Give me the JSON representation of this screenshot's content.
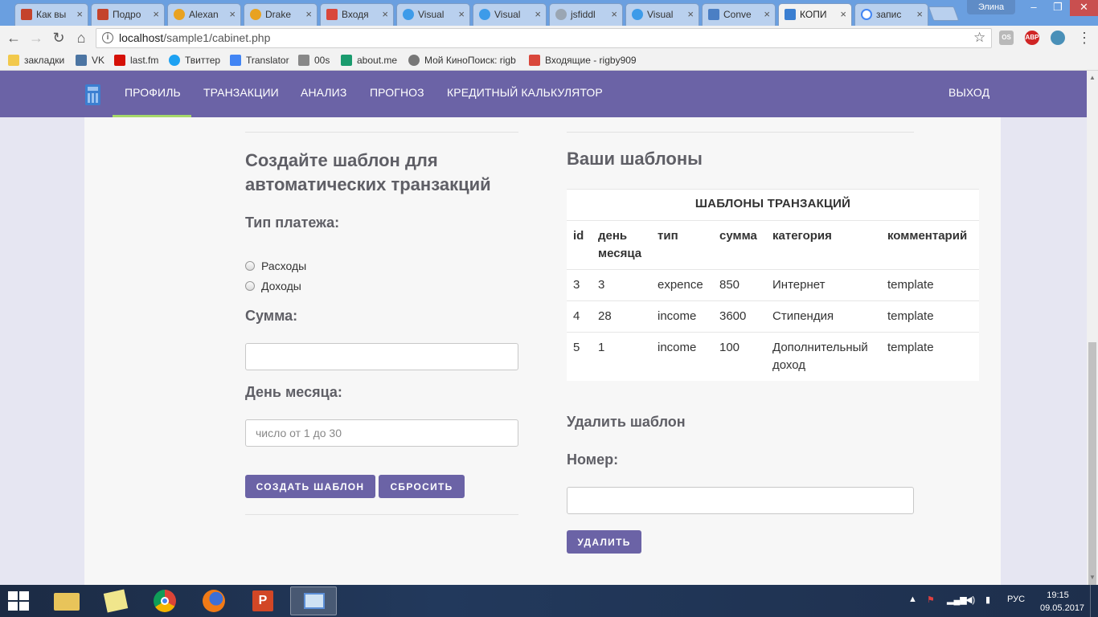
{
  "browser": {
    "tabs": [
      {
        "label": "Как вы",
        "favicon": "ru-site-icon"
      },
      {
        "label": "Подро",
        "favicon": "ru-site-icon"
      },
      {
        "label": "Alexan",
        "favicon": "music-icon"
      },
      {
        "label": "Drake",
        "favicon": "music-icon"
      },
      {
        "label": "Входя",
        "favicon": "gmail-icon"
      },
      {
        "label": "Visual",
        "favicon": "chrome-store-icon"
      },
      {
        "label": "Visual",
        "favicon": "chrome-store-icon"
      },
      {
        "label": "jsfiddl",
        "favicon": "jsfiddle-icon"
      },
      {
        "label": "Visual",
        "favicon": "chrome-store-icon"
      },
      {
        "label": "Conve",
        "favicon": "chat-icon"
      },
      {
        "label": "КОПИ",
        "favicon": "calculator-icon",
        "active": true
      },
      {
        "label": "запис",
        "favicon": "google-icon"
      }
    ],
    "user": "Элина",
    "url_host": "localhost",
    "url_path": "/sample1/cabinet.php",
    "bookmarks": [
      {
        "label": "закладки",
        "icon": "folder-icon"
      },
      {
        "label": "VK",
        "icon": "vk-icon"
      },
      {
        "label": "last.fm",
        "icon": "lastfm-icon"
      },
      {
        "label": "Твиттер",
        "icon": "twitter-icon"
      },
      {
        "label": "Translator",
        "icon": "translate-icon"
      },
      {
        "label": "00s",
        "icon": "calendar-icon"
      },
      {
        "label": "about.me",
        "icon": "aboutme-icon"
      },
      {
        "label": "Мой КиноПоиск: rigb",
        "icon": "film-icon"
      },
      {
        "label": "Входящие - rigby909",
        "icon": "gmail-icon"
      }
    ]
  },
  "nav": {
    "items": [
      "ПРОФИЛЬ",
      "ТРАНЗАКЦИИ",
      "АНАЛИЗ",
      "ПРОГНОЗ",
      "КРЕДИТНЫЙ КАЛЬКУЛЯТОР"
    ],
    "logout": "ВЫХОД"
  },
  "form": {
    "title": "Создайте шаблон для автоматических транзакций",
    "payment_type_label": "Тип платежа:",
    "options": [
      "Расходы",
      "Доходы"
    ],
    "amount_label": "Сумма:",
    "amount_value": "",
    "day_label": "День месяца:",
    "day_placeholder": "число от 1 до 30",
    "create_button": "СОЗДАТЬ ШАБЛОН",
    "reset_button": "СБРОСИТЬ"
  },
  "templates": {
    "title": "Ваши шаблоны",
    "caption": "ШАБЛОНЫ ТРАНЗАКЦИЙ",
    "columns": [
      "id",
      "день месяца",
      "тип",
      "сумма",
      "категория",
      "комментарий"
    ],
    "rows": [
      [
        "3",
        "3",
        "expence",
        "850",
        "Интернет",
        "template"
      ],
      [
        "4",
        "28",
        "income",
        "3600",
        "Стипендия",
        "template"
      ],
      [
        "5",
        "1",
        "income",
        "100",
        "Дополнительный доход",
        "template"
      ]
    ]
  },
  "delete": {
    "title": "Удалить шаблон",
    "number_label": "Номер:",
    "number_value": "",
    "button": "УДАЛИТЬ"
  },
  "taskbar": {
    "apps": [
      "file-explorer-icon",
      "sticky-notes-icon",
      "chrome-icon",
      "firefox-icon",
      "powerpoint-icon",
      "remote-desktop-icon"
    ],
    "language": "РУС",
    "time": "19:15",
    "date": "09.05.2017"
  },
  "colors": {
    "nav_bg": "#6b63a6",
    "accent_underline": "#a6d86a",
    "button_bg": "#6b63a6"
  }
}
